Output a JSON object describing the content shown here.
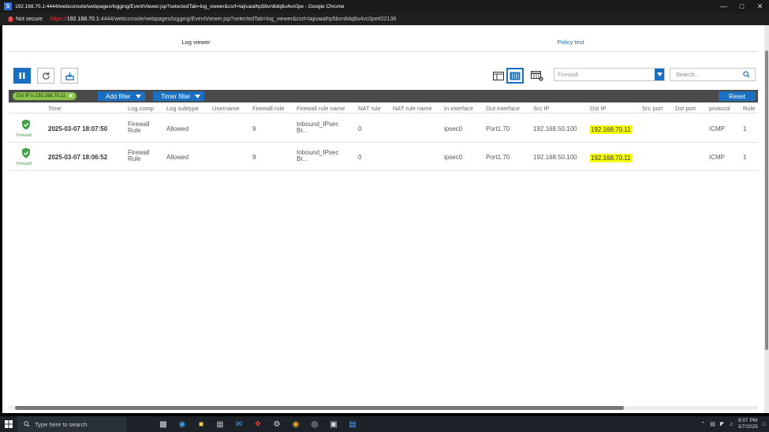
{
  "window": {
    "title": "192.168.70.1:4444/webconsole/webpages/logging/EventViewer.jsp?selectedTab=log_viewer&csrf=lajivaialhp5bvn8dq8u4vc0pe - Google Chrome",
    "app_letter": "S"
  },
  "address_bar": {
    "not_secure": "Not secure",
    "url_scheme": "https://",
    "url_host": "192.168.70.1",
    "url_rest": ":4444/webconsole/webpages/logging/EventViewer.jsp?selectedTab=log_viewer&csrf=lajivaialhp5bvn8dq8u4vc0pe#22136"
  },
  "tabs": [
    {
      "label": "Log viewer",
      "active": true
    },
    {
      "label": "Policy test",
      "active": false
    }
  ],
  "toolbar": {
    "module_select_value": "Firewall",
    "search_placeholder": "Search..."
  },
  "filter_bar": {
    "chip_label": "Dst IP is 192.168.70.11",
    "chip_remove": "✖",
    "add_filter": "Add filter",
    "timer_filter": "Timer filter",
    "reset": "Reset"
  },
  "table": {
    "columns": [
      "Time",
      "Log comp",
      "Log subtype",
      "Username",
      "Firewall rule",
      "Firewall rule name",
      "NAT rule",
      "NAT rule name",
      "In interface",
      "Out interface",
      "Src IP",
      "Dst IP",
      "Src port",
      "Dst port",
      "protocol",
      "Rule"
    ],
    "rows": [
      {
        "icon_label": "Firewall",
        "time": "2025-03-07 18:07:50",
        "log_comp_1": "Firewall",
        "log_comp_2": "Rule",
        "log_subtype": "Allowed",
        "username": "",
        "firewall_rule": "9",
        "rule_name_1": "Inbound_IPsec",
        "rule_name_2": "Br...",
        "nat_rule": "0",
        "nat_rule_name": "",
        "in_interface": "ipsec0",
        "out_interface": "Port1.70",
        "src_ip": "192.168.50.100",
        "dst_ip": "192.168.70.11",
        "src_port": "",
        "dst_port": "",
        "protocol": "ICMP",
        "rule": "1"
      },
      {
        "icon_label": "Firewall",
        "time": "2025-03-07 18:06:52",
        "log_comp_1": "Firewall",
        "log_comp_2": "Rule",
        "log_subtype": "Allowed",
        "username": "",
        "firewall_rule": "9",
        "rule_name_1": "Inbound_IPsec",
        "rule_name_2": "Br...",
        "nat_rule": "0",
        "nat_rule_name": "",
        "in_interface": "ipsec0",
        "out_interface": "Port1.70",
        "src_ip": "192.168.50.100",
        "dst_ip": "192.168.70.11",
        "src_port": "",
        "dst_port": "",
        "protocol": "ICMP",
        "rule": "1"
      }
    ]
  },
  "taskbar": {
    "search_placeholder": "Type here to search",
    "time": "6:07 PM",
    "date": "3/7/2025"
  },
  "colors": {
    "accent": "#1a6fc0",
    "chip": "#8bc34a",
    "highlight": "#f6ff00",
    "allowed_green": "#43a047"
  }
}
